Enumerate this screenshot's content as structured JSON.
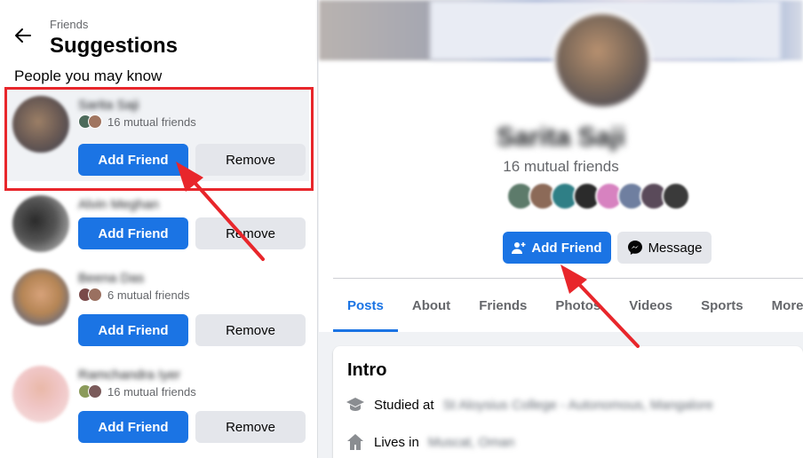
{
  "header": {
    "breadcrumb": "Friends",
    "title": "Suggestions",
    "section": "People you may know"
  },
  "suggestions": [
    {
      "name": "Sarita Saji",
      "mutual": "16 mutual friends",
      "add_label": "Add Friend",
      "remove_label": "Remove"
    },
    {
      "name": "Alvin Meghan",
      "mutual": "",
      "add_label": "Add Friend",
      "remove_label": "Remove"
    },
    {
      "name": "Beena Das",
      "mutual": "6 mutual friends",
      "add_label": "Add Friend",
      "remove_label": "Remove"
    },
    {
      "name": "Ramchandra Iyer",
      "mutual": "16 mutual friends",
      "add_label": "Add Friend",
      "remove_label": "Remove"
    }
  ],
  "profile": {
    "name": "Sarita Saji",
    "mutual": "16 mutual friends",
    "add_label": "Add Friend",
    "message_label": "Message"
  },
  "tabs": [
    "Posts",
    "About",
    "Friends",
    "Photos",
    "Videos",
    "Sports",
    "More"
  ],
  "intro": {
    "title": "Intro",
    "studied_prefix": "Studied at",
    "studied_value": "St Aloysius College - Autonomous, Mangalore",
    "lives_prefix": "Lives in",
    "lives_value": "Muscat, Oman"
  },
  "colors": {
    "accent": "#1b74e4",
    "annotation_red": "#e8262b"
  }
}
